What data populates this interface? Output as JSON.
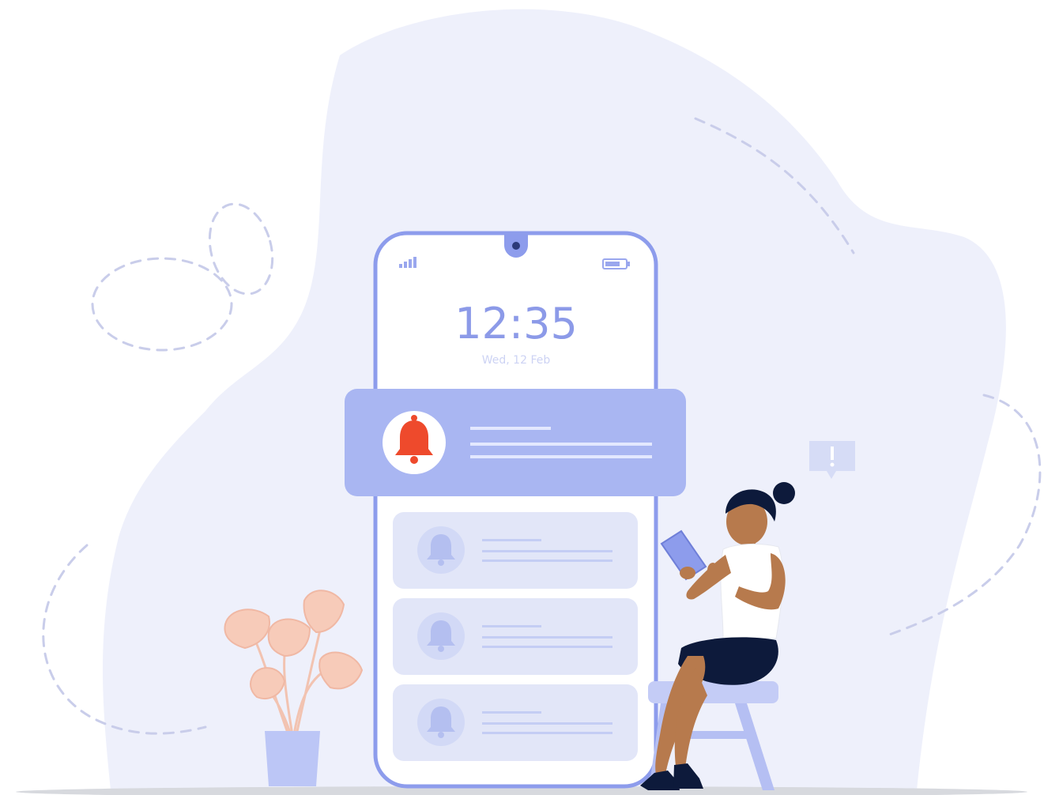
{
  "phone": {
    "time": "12:35",
    "date": "Wed, 12 Feb"
  },
  "colors": {
    "background": "#ffffff",
    "blob": "#eef0fb",
    "phone_outline": "#8d9cec",
    "active_card": "#a9b6f2",
    "inactive_card": "#e2e6f8",
    "bell_active": "#ee4a2c",
    "bell_inactive": "#b4bff0",
    "skirt": "#0d1a3b",
    "skin": "#b77a4d",
    "plant": "#f5c9b8",
    "pot": "#bcc6f6"
  },
  "notifications": {
    "active_icon": "bell-icon",
    "inactive_icon": "bell-icon",
    "inactive_count": 3
  },
  "alert_badge_icon": "exclamation-icon"
}
